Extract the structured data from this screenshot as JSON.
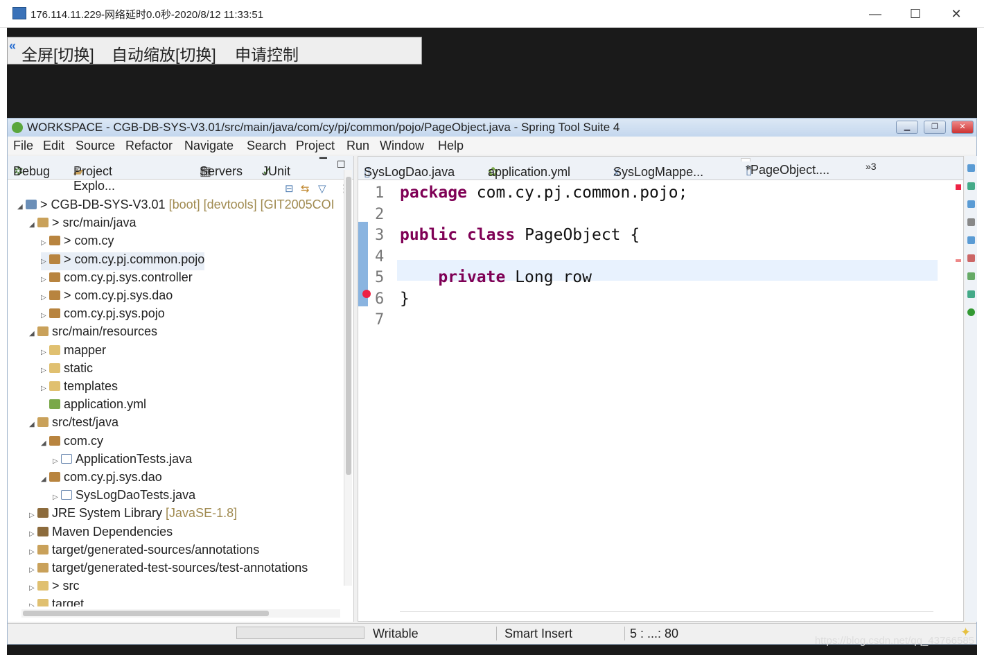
{
  "remote": {
    "title": "176.114.11.229-网络延时0.0秒-2020/8/12 11:33:51",
    "toolbar": [
      "全屏[切换]",
      "自动缩放[切换]",
      "申请控制"
    ]
  },
  "sts": {
    "title": "WORKSPACE - CGB-DB-SYS-V3.01/src/main/java/com/cy/pj/common/pojo/PageObject.java - Spring Tool Suite 4",
    "menu": [
      "File",
      "Edit",
      "Source",
      "Refactor",
      "Navigate",
      "Search",
      "Project",
      "Run",
      "Window",
      "Help"
    ],
    "left_tabs": [
      "Debug",
      "Project Explo...",
      "Servers",
      "JUnit"
    ],
    "tree": [
      {
        "indent": 0,
        "arrow": "◢",
        "icon": "proj",
        "label": "> CGB-DB-SYS-V3.01",
        "extra": " [boot] [devtools] [GIT2005COI"
      },
      {
        "indent": 1,
        "arrow": "◢",
        "icon": "src",
        "label": "> src/main/java",
        "extra": ""
      },
      {
        "indent": 2,
        "arrow": "▷",
        "icon": "pkg",
        "label": "> com.cy",
        "extra": ""
      },
      {
        "indent": 2,
        "arrow": "▷",
        "icon": "pkg",
        "label": "> com.cy.pj.common.pojo",
        "extra": ""
      },
      {
        "indent": 2,
        "arrow": "▷",
        "icon": "pkg",
        "label": "com.cy.pj.sys.controller",
        "extra": ""
      },
      {
        "indent": 2,
        "arrow": "▷",
        "icon": "pkg",
        "label": "> com.cy.pj.sys.dao",
        "extra": ""
      },
      {
        "indent": 2,
        "arrow": "▷",
        "icon": "pkg",
        "label": "com.cy.pj.sys.pojo",
        "extra": ""
      },
      {
        "indent": 1,
        "arrow": "◢",
        "icon": "src",
        "label": "src/main/resources",
        "extra": ""
      },
      {
        "indent": 2,
        "arrow": "▷",
        "icon": "fold",
        "label": "mapper",
        "extra": ""
      },
      {
        "indent": 2,
        "arrow": "▷",
        "icon": "fold",
        "label": "static",
        "extra": ""
      },
      {
        "indent": 2,
        "arrow": "▷",
        "icon": "fold",
        "label": "templates",
        "extra": ""
      },
      {
        "indent": 2,
        "arrow": "",
        "icon": "yml",
        "label": "application.yml",
        "extra": ""
      },
      {
        "indent": 1,
        "arrow": "◢",
        "icon": "src",
        "label": "src/test/java",
        "extra": ""
      },
      {
        "indent": 2,
        "arrow": "◢",
        "icon": "pkg",
        "label": "com.cy",
        "extra": ""
      },
      {
        "indent": 3,
        "arrow": "▷",
        "icon": "java",
        "label": "ApplicationTests.java",
        "extra": ""
      },
      {
        "indent": 2,
        "arrow": "◢",
        "icon": "pkg",
        "label": "com.cy.pj.sys.dao",
        "extra": ""
      },
      {
        "indent": 3,
        "arrow": "▷",
        "icon": "java",
        "label": "SysLogDaoTests.java",
        "extra": ""
      },
      {
        "indent": 1,
        "arrow": "▷",
        "icon": "lib",
        "label": "JRE System Library",
        "extra": " [JavaSE-1.8]"
      },
      {
        "indent": 1,
        "arrow": "▷",
        "icon": "lib",
        "label": "Maven Dependencies",
        "extra": ""
      },
      {
        "indent": 1,
        "arrow": "▷",
        "icon": "src",
        "label": "target/generated-sources/annotations",
        "extra": ""
      },
      {
        "indent": 1,
        "arrow": "▷",
        "icon": "src",
        "label": "target/generated-test-sources/test-annotations",
        "extra": ""
      },
      {
        "indent": 1,
        "arrow": "▷",
        "icon": "fold",
        "label": "> src",
        "extra": ""
      },
      {
        "indent": 1,
        "arrow": "▷",
        "icon": "fold",
        "label": "target",
        "extra": ""
      }
    ],
    "editor_tabs": [
      "SysLogDao.java",
      "application.yml",
      "SysLogMappe...",
      "*PageObject...."
    ],
    "overflow_tabs": "»3",
    "code": [
      {
        "n": "1",
        "parts": [
          [
            "kw",
            "package"
          ],
          [
            "",
            "com.cy.pj.common.pojo;"
          ]
        ]
      },
      {
        "n": "2",
        "parts": []
      },
      {
        "n": "3",
        "parts": [
          [
            "kw",
            "public"
          ],
          [
            "kw",
            "class"
          ],
          [
            "",
            "PageObject {"
          ]
        ]
      },
      {
        "n": "4",
        "parts": []
      },
      {
        "n": "5",
        "parts": [
          [
            "",
            "   "
          ],
          [
            "kw",
            "private"
          ],
          [
            "",
            "Long row"
          ]
        ]
      },
      {
        "n": "6",
        "parts": [
          [
            "",
            "}"
          ]
        ]
      },
      {
        "n": "7",
        "parts": []
      }
    ],
    "status": {
      "mode": "Writable",
      "insert": "Smart Insert",
      "pos": "5 : ...: 80"
    }
  },
  "watermark": "https://blog.csdn.net/qq_43766585"
}
